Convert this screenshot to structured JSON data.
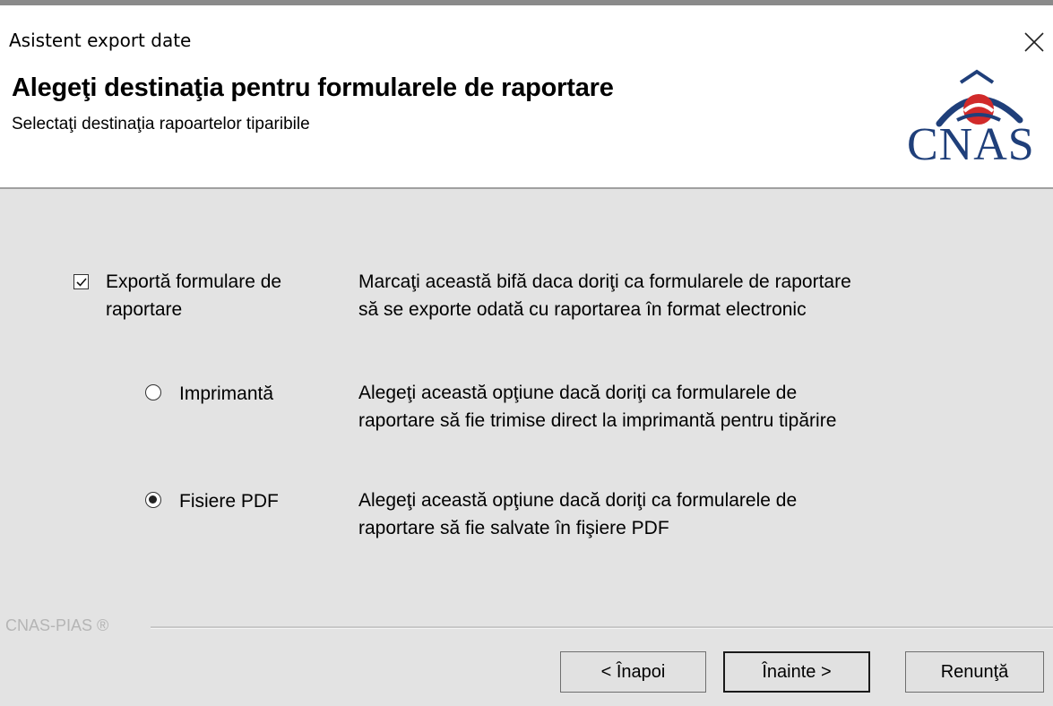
{
  "window": {
    "title": "Asistent export date",
    "close_glyph": "close-icon"
  },
  "header": {
    "title": "Alegeţi destinaţia pentru formularele de raportare",
    "subtitle": "Selectaţi destinaţia rapoartelor tiparibile",
    "logo_text": "CNAS",
    "logo_colors": {
      "text": "#1f3f7a",
      "arc": "#1f3f7a",
      "accent": "#d12a2a"
    }
  },
  "options": {
    "export_checkbox": {
      "label_line1": "Exportă formulare de",
      "label_line2": "raportare",
      "checked": true,
      "desc_line1": "Marcaţi această bifă daca doriţi ca formularele de raportare",
      "desc_line2": "să se exporte odată cu raportarea în format electronic"
    },
    "printer_radio": {
      "label": "Imprimantă",
      "selected": false,
      "desc_line1": "Alegeţi această opţiune dacă doriţi ca formularele de",
      "desc_line2": "raportare să fie trimise direct la imprimantă pentru tipărire"
    },
    "pdf_radio": {
      "label": "Fisiere PDF",
      "selected": true,
      "desc_line1": "Alegeţi această opţiune dacă doriţi ca formularele de",
      "desc_line2": "raportare să fie salvate în fişiere PDF"
    }
  },
  "footer": {
    "brand": "CNAS-PIAS ®",
    "buttons": {
      "back": "< Înapoi",
      "next": "Înainte >",
      "cancel": "Renunţă"
    }
  },
  "colors": {
    "panel_bg": "#e3e3e3",
    "header_bg": "#ffffff",
    "brand_text": "#b5b5b5"
  }
}
